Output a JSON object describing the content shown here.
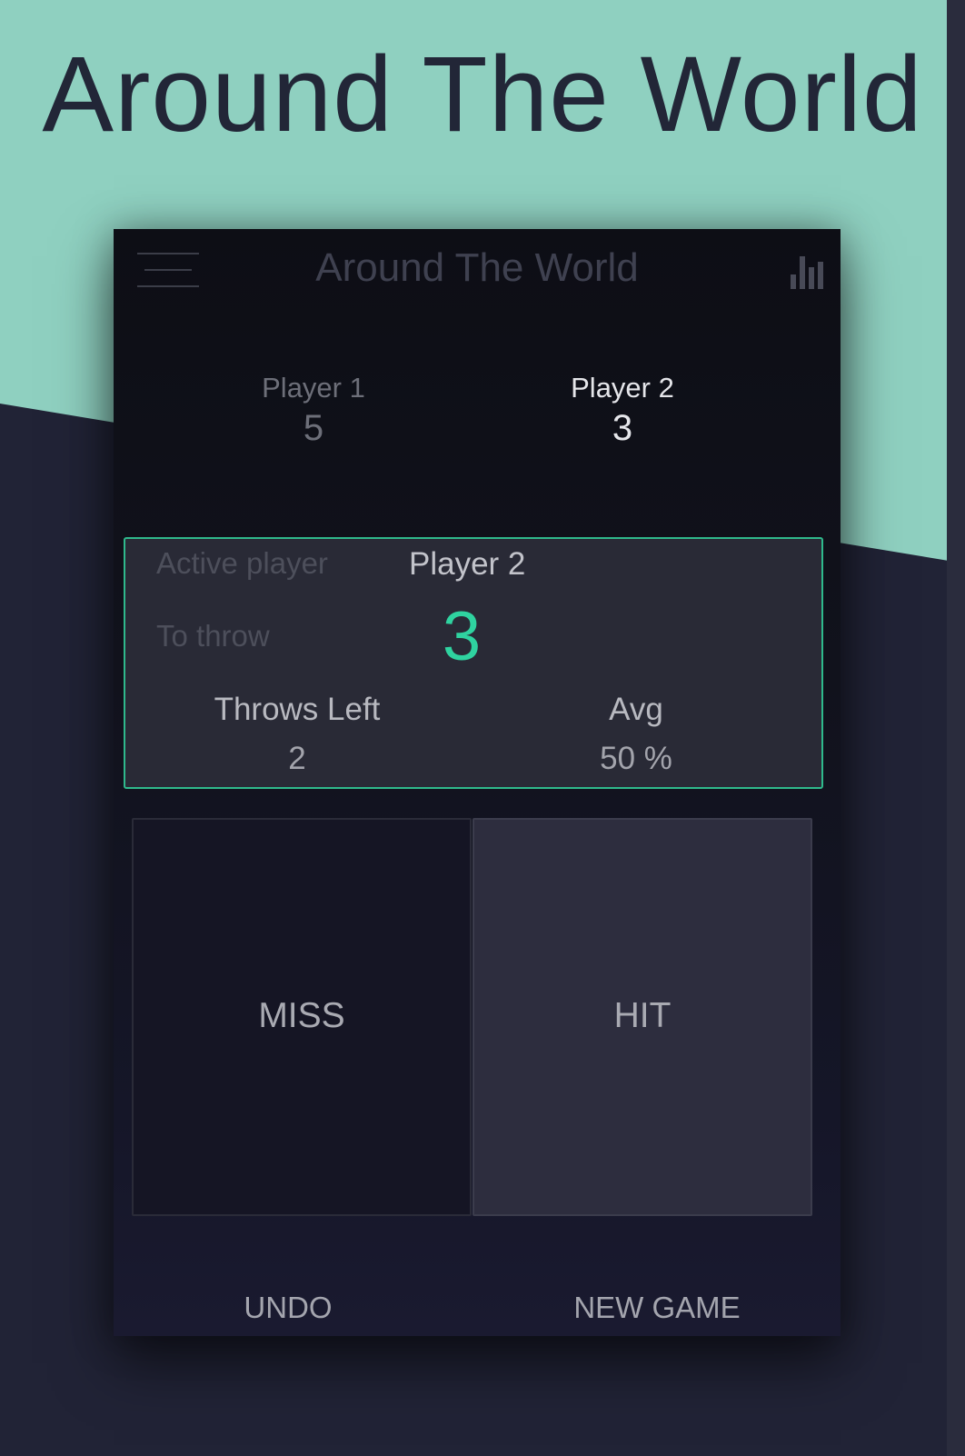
{
  "promo": {
    "headline": "Around The World"
  },
  "app_bar": {
    "title": "Around The World",
    "menu_icon": "hamburger-menu-icon",
    "stats_icon": "bar-chart-icon"
  },
  "players": [
    {
      "name": "Player 1",
      "score": "5",
      "active": false
    },
    {
      "name": "Player 2",
      "score": "3",
      "active": true
    }
  ],
  "active_panel": {
    "active_player_label": "Active player",
    "active_player_value": "Player 2",
    "to_throw_label": "To throw",
    "to_throw_value": "3",
    "throws_left_label": "Throws Left",
    "throws_left_value": "2",
    "avg_label": "Avg",
    "avg_value": "50 %"
  },
  "actions": {
    "miss_label": "MISS",
    "hit_label": "HIT",
    "undo_label": "UNDO",
    "new_game_label": "NEW GAME"
  },
  "colors": {
    "accent": "#2fd3a0",
    "panel_border": "#2fb98c",
    "mint_background": "#8fd0c0",
    "dark_background": "#212336"
  }
}
